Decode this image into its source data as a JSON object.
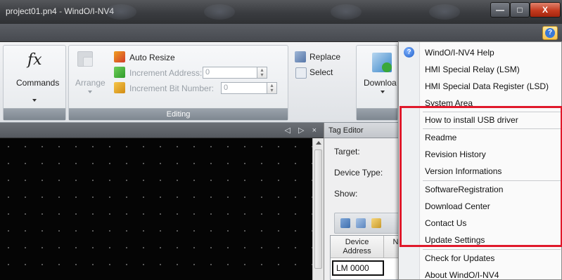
{
  "window": {
    "title_file": "project01.pn4",
    "title_sep": " - ",
    "title_app": "WindO/I-NV4",
    "minimize_glyph": "—",
    "maximize_glyph": "□",
    "close_glyph": "X"
  },
  "help_button": {
    "glyph": "?"
  },
  "ribbon": {
    "commands_fx": "fx",
    "commands_label": "Commands",
    "arrange_label": "Arrange",
    "auto_resize": "Auto Resize",
    "increment_address_label": "Increment Address:",
    "increment_address_value": "0",
    "increment_bit_label": "Increment Bit Number:",
    "increment_bit_value": "0",
    "replace": "Replace",
    "select": "Select",
    "download": "Downloa",
    "editing_group": "Editing"
  },
  "workspace": {
    "panel_controls": "◁ ▷ ×"
  },
  "tag_editor": {
    "title": "Tag Editor",
    "target_label": "Target:",
    "device_type_label": "Device Type:",
    "show_label": "Show:",
    "col_device_address": "Device Address",
    "col_name_partial": "N",
    "row1_address": "LM 0000"
  },
  "help_menu": {
    "items": [
      "WindO/I-NV4 Help",
      "HMI Special Relay (LSM)",
      "HMI Special Data Register (LSD)",
      "System Area",
      "How to install USB driver",
      "Readme",
      "Revision History",
      "Version Informations",
      "SoftwareRegistration",
      "Download Center",
      "Contact Us",
      "Update Settings",
      "Check for Updates",
      "About WindO/I-NV4"
    ]
  },
  "colors": {
    "highlight_box": "#e0192b",
    "help_icon_blue": "#1f5fc8",
    "titlebar_dark": "#3a3c40"
  }
}
